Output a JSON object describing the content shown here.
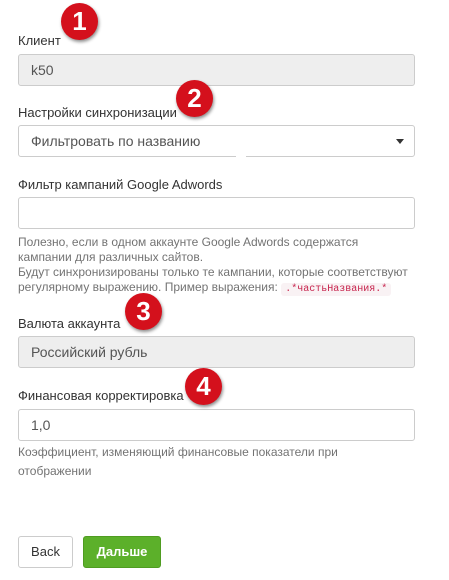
{
  "client": {
    "label": "Клиент",
    "value": "k50"
  },
  "sync_settings": {
    "label": "Настройки синхронизации",
    "selected": "Фильтровать по названию"
  },
  "campaign_filter": {
    "label": "Фильтр кампаний Google Adwords",
    "value": "",
    "help_line1": "Полезно, если в одном аккаунте Google Adwords содержатся",
    "help_line2": "кампании для различных сайтов.",
    "help_line3": "Будут синхронизированы только те кампании, которые соответствуют",
    "help_line4_prefix": "регулярному выражению. Пример выражения:",
    "example_code": ".*частьНазвания.*"
  },
  "currency": {
    "label": "Валюта аккаунта",
    "value": "Российский рубль"
  },
  "financial_adjustment": {
    "label": "Финансовая корректировка",
    "value": "1,0",
    "help_line1": "Коэффициент, изменяющий финансовые показатели при",
    "help_line2": "отображении"
  },
  "badges": [
    "1",
    "2",
    "3",
    "4"
  ],
  "buttons": {
    "back": "Back",
    "next": "Дальше"
  },
  "colors": {
    "badge": "#d4101c",
    "primary_button": "#5cb02a"
  }
}
